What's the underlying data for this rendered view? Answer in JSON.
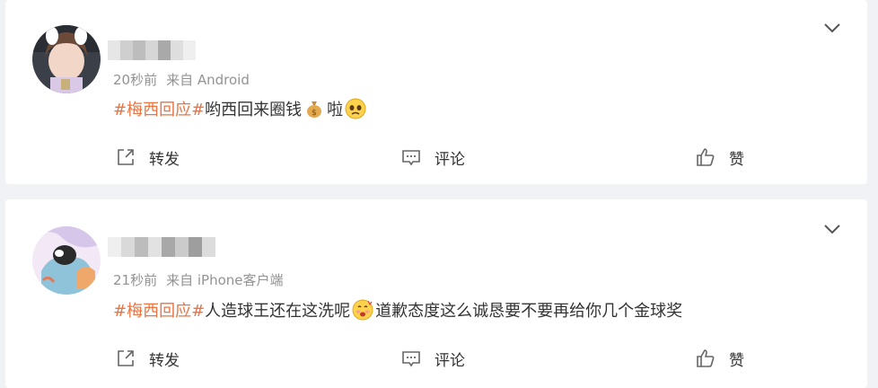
{
  "posts": [
    {
      "meta_time": "20秒前",
      "meta_source": "来自 Android",
      "tag": "#梅西回应#",
      "text_a": "哟西回来圈钱",
      "text_b": "啦",
      "actions": {
        "repost": "转发",
        "comment": "评论",
        "like": "赞"
      }
    },
    {
      "meta_time": "21秒前",
      "meta_source": "来自 iPhone客户端",
      "tag": "#梅西回应#",
      "text_a": "人造球王还在这洗呢",
      "text_b": "道歉态度这么诚恳要不要再给你几个金球奖",
      "actions": {
        "repost": "转发",
        "comment": "评论",
        "like": "赞"
      }
    }
  ],
  "colors": {
    "accent": "#eb7340",
    "meta": "#939393",
    "background": "#f1f2f5"
  }
}
